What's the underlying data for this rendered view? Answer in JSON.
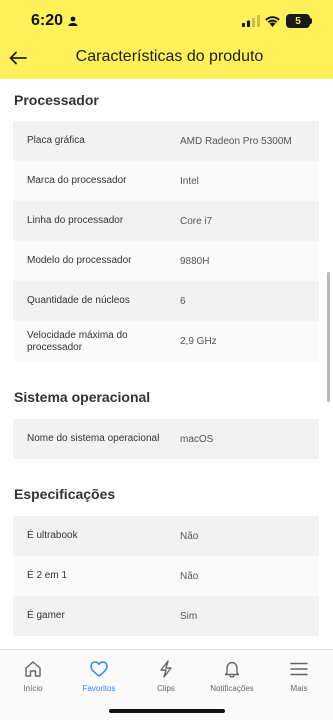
{
  "status_bar": {
    "time": "6:20",
    "battery": "5"
  },
  "header": {
    "title": "Características do produto"
  },
  "sections": [
    {
      "title": "Processador",
      "rows": [
        {
          "label": "Placa gráfica",
          "value": "AMD Radeon Pro 5300M"
        },
        {
          "label": "Marca do processador",
          "value": "Intel"
        },
        {
          "label": "Linha do processador",
          "value": "Core i7"
        },
        {
          "label": "Modelo do processador",
          "value": "9880H"
        },
        {
          "label": "Quantidade de núcleos",
          "value": "6"
        },
        {
          "label": "Velocidade máxima do processador",
          "value": "2,9 GHz"
        }
      ]
    },
    {
      "title": "Sistema operacional",
      "rows": [
        {
          "label": "Nome do sistema operacional",
          "value": "macOS"
        }
      ]
    },
    {
      "title": "Especificações",
      "rows": [
        {
          "label": "É ultrabook",
          "value": "Não"
        },
        {
          "label": "É 2 em 1",
          "value": "Não"
        },
        {
          "label": "É gamer",
          "value": "Sim"
        }
      ]
    }
  ],
  "tab_bar": {
    "active": "Favoritos",
    "active_color": "#3483fa",
    "items": [
      {
        "label": "Início",
        "icon": "home-icon"
      },
      {
        "label": "Favoritos",
        "icon": "heart-icon"
      },
      {
        "label": "Clips",
        "icon": "clips-icon"
      },
      {
        "label": "Notificações",
        "icon": "bell-icon"
      },
      {
        "label": "Mais",
        "icon": "menu-icon"
      }
    ]
  },
  "colors": {
    "header_bg": "#fff159",
    "accent": "#3483fa"
  }
}
